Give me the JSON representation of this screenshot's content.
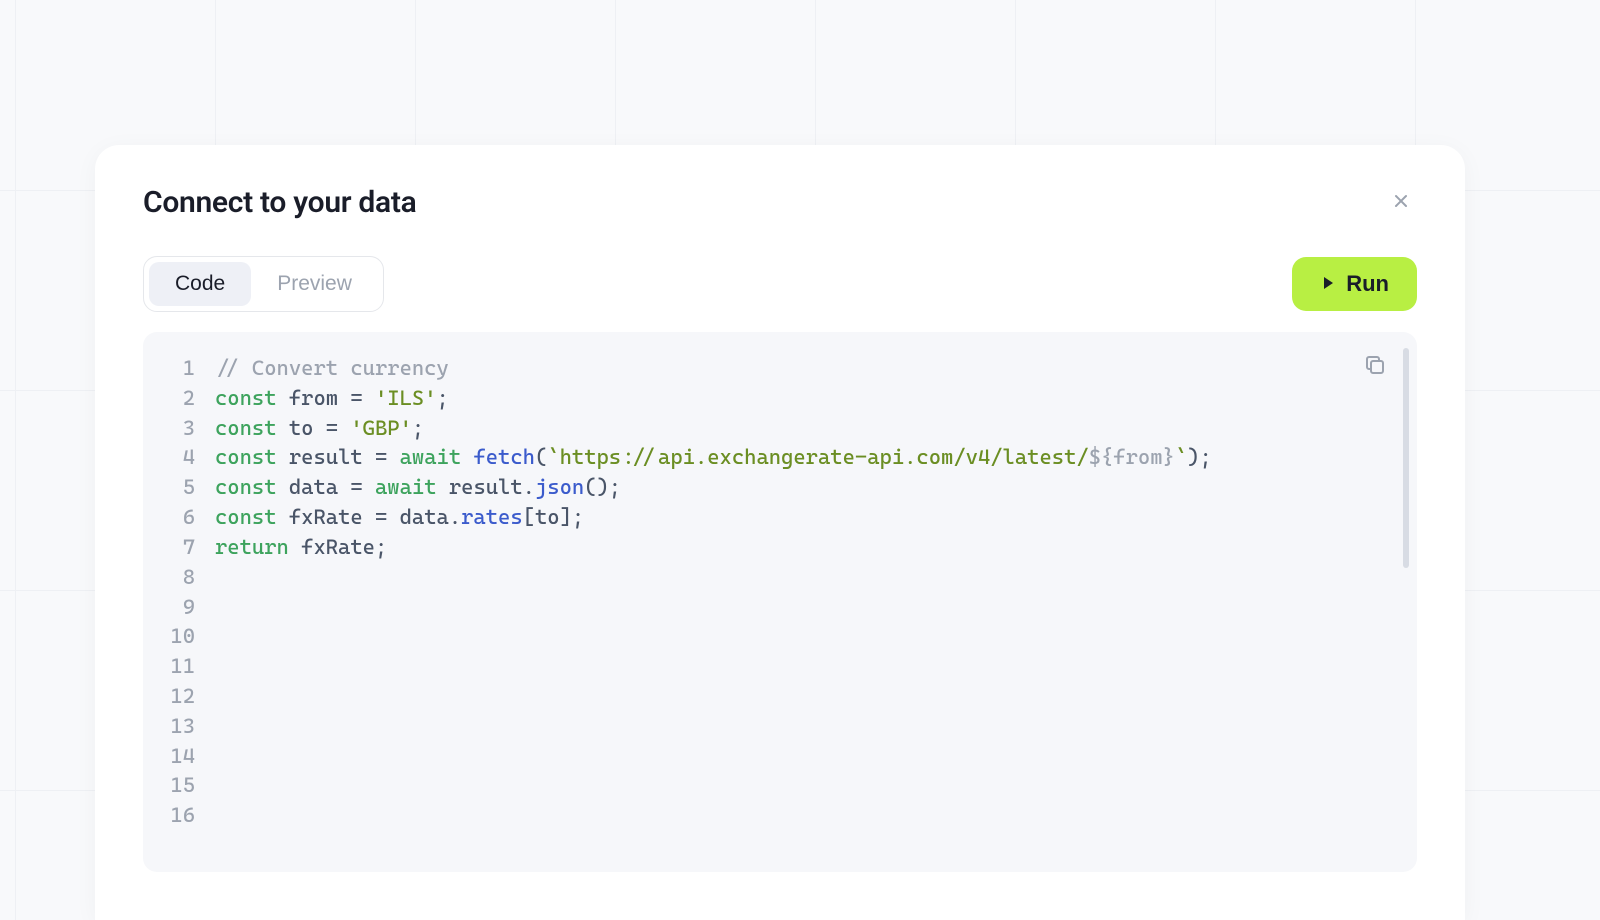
{
  "modal": {
    "title": "Connect to your data"
  },
  "tabs": {
    "code_label": "Code",
    "preview_label": "Preview",
    "active": "code"
  },
  "run": {
    "label": "Run"
  },
  "code": {
    "total_lines": 16,
    "lines": [
      {
        "n": 1,
        "tokens": [
          {
            "cls": "tok-comment",
            "t": "// Convert currency"
          }
        ]
      },
      {
        "n": 2,
        "tokens": [
          {
            "cls": "tok-keyword",
            "t": "const"
          },
          {
            "cls": "tok-punct",
            "t": " "
          },
          {
            "cls": "tok-ident",
            "t": "from"
          },
          {
            "cls": "tok-punct",
            "t": " = "
          },
          {
            "cls": "tok-string",
            "t": "'ILS'"
          },
          {
            "cls": "tok-punct",
            "t": ";"
          }
        ]
      },
      {
        "n": 3,
        "tokens": [
          {
            "cls": "tok-keyword",
            "t": "const"
          },
          {
            "cls": "tok-punct",
            "t": " "
          },
          {
            "cls": "tok-ident",
            "t": "to"
          },
          {
            "cls": "tok-punct",
            "t": " = "
          },
          {
            "cls": "tok-string",
            "t": "'GBP'"
          },
          {
            "cls": "tok-punct",
            "t": ";"
          }
        ]
      },
      {
        "n": 4,
        "tokens": [
          {
            "cls": "tok-keyword",
            "t": "const"
          },
          {
            "cls": "tok-punct",
            "t": " "
          },
          {
            "cls": "tok-ident",
            "t": "result"
          },
          {
            "cls": "tok-punct",
            "t": " = "
          },
          {
            "cls": "tok-keyword",
            "t": "await"
          },
          {
            "cls": "tok-punct",
            "t": " "
          },
          {
            "cls": "tok-fn",
            "t": "fetch"
          },
          {
            "cls": "tok-punct",
            "t": "("
          },
          {
            "cls": "tok-string",
            "t": "`https://api.exchangerate-api.com/v4/latest/"
          },
          {
            "cls": "tok-tmpl",
            "t": "${from}"
          },
          {
            "cls": "tok-string",
            "t": "`"
          },
          {
            "cls": "tok-punct",
            "t": ");"
          }
        ]
      },
      {
        "n": 5,
        "tokens": [
          {
            "cls": "tok-keyword",
            "t": "const"
          },
          {
            "cls": "tok-punct",
            "t": " "
          },
          {
            "cls": "tok-ident",
            "t": "data"
          },
          {
            "cls": "tok-punct",
            "t": " = "
          },
          {
            "cls": "tok-keyword",
            "t": "await"
          },
          {
            "cls": "tok-punct",
            "t": " "
          },
          {
            "cls": "tok-ident-use",
            "t": "result"
          },
          {
            "cls": "tok-punct",
            "t": "."
          },
          {
            "cls": "tok-fn",
            "t": "json"
          },
          {
            "cls": "tok-punct",
            "t": "();"
          }
        ]
      },
      {
        "n": 6,
        "tokens": [
          {
            "cls": "tok-keyword",
            "t": "const"
          },
          {
            "cls": "tok-punct",
            "t": " "
          },
          {
            "cls": "tok-ident",
            "t": "fxRate"
          },
          {
            "cls": "tok-punct",
            "t": " = "
          },
          {
            "cls": "tok-ident-use",
            "t": "data"
          },
          {
            "cls": "tok-punct",
            "t": "."
          },
          {
            "cls": "tok-prop",
            "t": "rates"
          },
          {
            "cls": "tok-punct",
            "t": "["
          },
          {
            "cls": "tok-ident-use",
            "t": "to"
          },
          {
            "cls": "tok-punct",
            "t": "];"
          }
        ]
      },
      {
        "n": 7,
        "tokens": [
          {
            "cls": "tok-keyword",
            "t": "return"
          },
          {
            "cls": "tok-punct",
            "t": " "
          },
          {
            "cls": "tok-ident-use",
            "t": "fxRate"
          },
          {
            "cls": "tok-punct",
            "t": ";"
          }
        ]
      }
    ]
  }
}
